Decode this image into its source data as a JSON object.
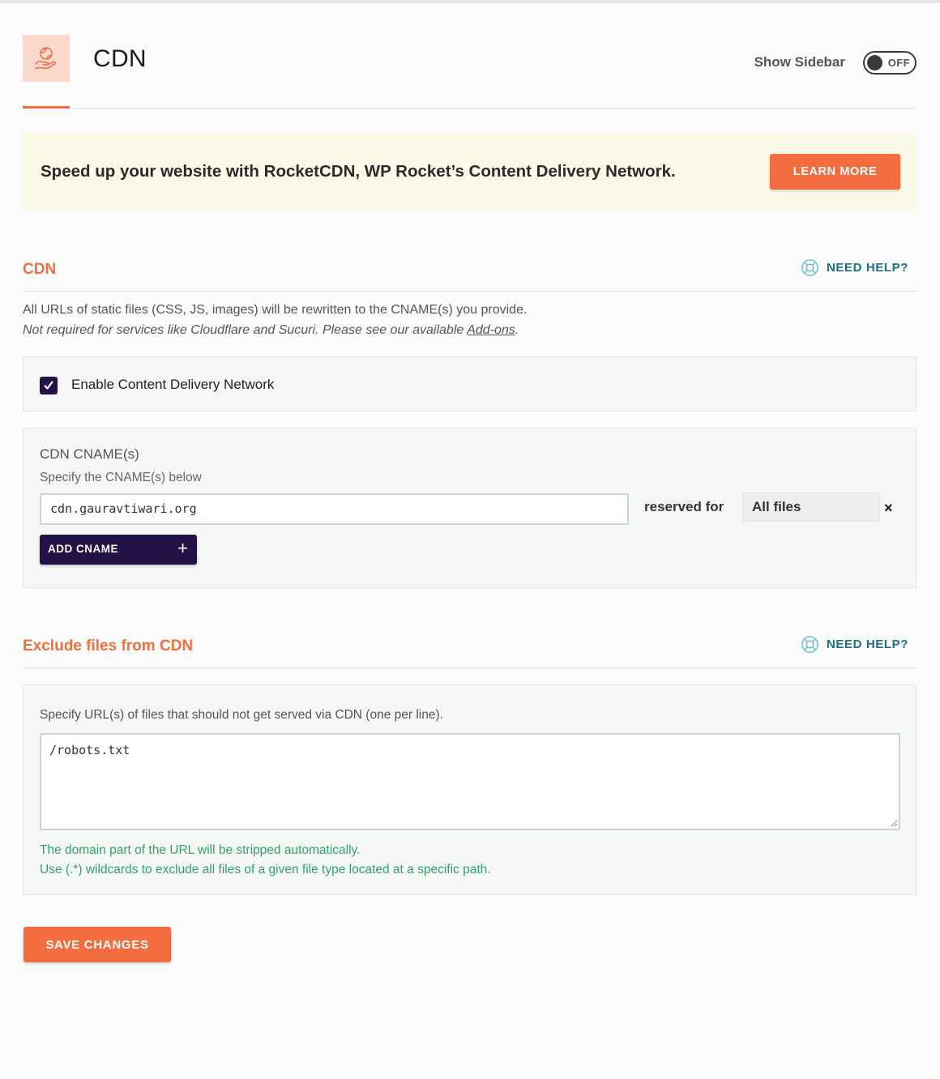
{
  "header": {
    "title": "CDN",
    "sidebar_label": "Show Sidebar",
    "toggle_state": "OFF",
    "icon": "globe-hand-icon"
  },
  "banner": {
    "text": "Speed up your website with RocketCDN, WP Rocket’s Content Delivery Network.",
    "button_label": "LEARN MORE"
  },
  "cdn_section": {
    "title": "CDN",
    "help_label": "NEED HELP?",
    "description_line1": "All URLs of static files (CSS, JS, images) will be rewritten to the CNAME(s) you provide.",
    "description_line2": "Not required for services like Cloudflare and Sucuri. Please see our available",
    "addons_link": "Add-ons",
    "period": ".",
    "enable_label": "Enable Content Delivery Network",
    "enable_checked": true
  },
  "cname": {
    "title": "CDN CNAME(s)",
    "subtitle": "Specify the CNAME(s) below",
    "value": "cdn.gauravtiwari.org",
    "reserved_label": "reserved for",
    "reserved_value": "All files",
    "remove_symbol": "×",
    "add_label": "ADD CNAME",
    "add_symbol": "+"
  },
  "exclude_section": {
    "title": "Exclude files from CDN",
    "help_label": "NEED HELP?",
    "instruction": "Specify URL(s) of files that should not get served via CDN (one per line).",
    "value": "/robots.txt",
    "hint_line1": "The domain part of the URL will be stripped automatically.",
    "hint_line2": "Use (.*) wildcards to exclude all files of a given file type located at a specific path."
  },
  "footer": {
    "save_label": "SAVE CHANGES"
  },
  "colors": {
    "accent": "#f26c3f",
    "dark": "#241246",
    "help": "#1e6f87",
    "hint": "#35a06a"
  }
}
